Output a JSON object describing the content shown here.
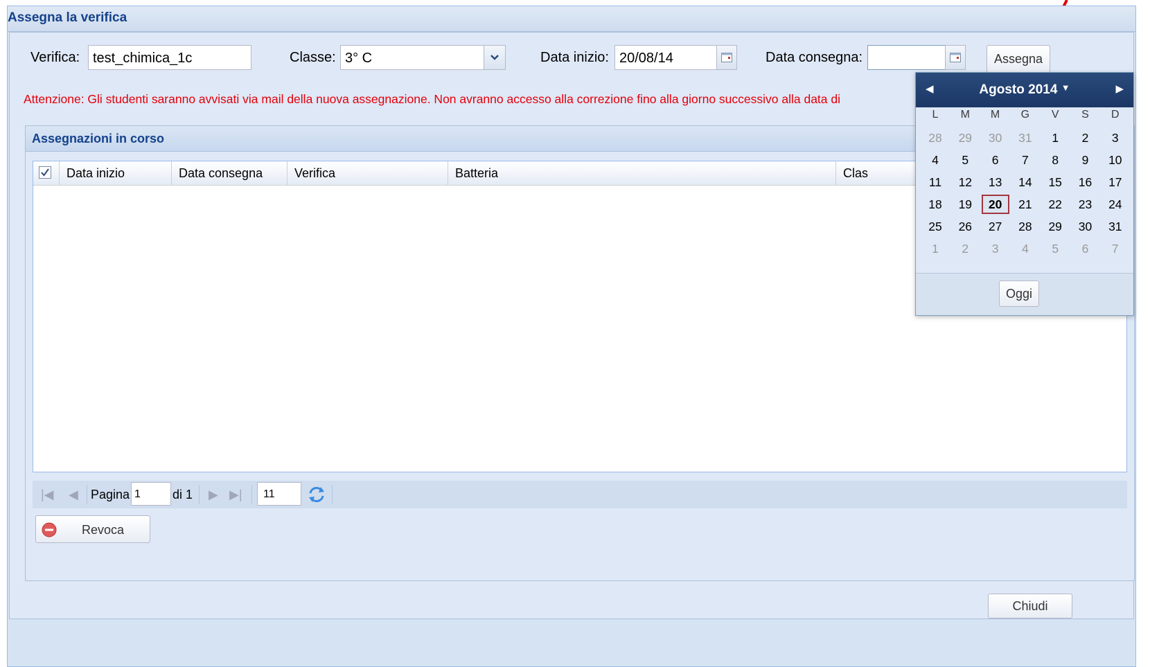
{
  "window": {
    "title": "Assegna la verifica"
  },
  "form": {
    "verifica_label": "Verifica:",
    "verifica_value": "test_chimica_1c",
    "classe_label": "Classe:",
    "classe_value": "3° C",
    "data_inizio_label": "Data inizio:",
    "data_inizio_value": "20/08/14",
    "data_consegna_label": "Data consegna:",
    "data_consegna_value": "",
    "assegna_label": "Assegna",
    "warning": "Attenzione: Gli studenti saranno avvisati via mail della nuova assegnazione. Non avranno accesso alla correzione fino alla giorno successivo alla data di"
  },
  "assignments": {
    "title": "Assegnazioni in corso",
    "columns": [
      "Data inizio",
      "Data consegna",
      "Verifica",
      "Batteria",
      "Clas"
    ],
    "rows": []
  },
  "pager": {
    "page_label": "Pagina",
    "page_value": "1",
    "of_label": "di 1",
    "page_size_value": "11"
  },
  "revoca_label": "Revoca",
  "chiudi_label": "Chiudi",
  "calendar": {
    "month_label": "Agosto 2014",
    "weekdays": [
      "L",
      "M",
      "M",
      "G",
      "V",
      "S",
      "D"
    ],
    "weeks": [
      [
        "28",
        "29",
        "30",
        "31",
        "1",
        "2",
        "3"
      ],
      [
        "4",
        "5",
        "6",
        "7",
        "8",
        "9",
        "10"
      ],
      [
        "11",
        "12",
        "13",
        "14",
        "15",
        "16",
        "17"
      ],
      [
        "18",
        "19",
        "20",
        "21",
        "22",
        "23",
        "24"
      ],
      [
        "25",
        "26",
        "27",
        "28",
        "29",
        "30",
        "31"
      ],
      [
        "1",
        "2",
        "3",
        "4",
        "5",
        "6",
        "7"
      ]
    ],
    "selected_day": "20",
    "today_label": "Oggi"
  },
  "colors": {
    "warning": "#e3000b",
    "title": "#15428b",
    "arrow": "#e3000b"
  }
}
